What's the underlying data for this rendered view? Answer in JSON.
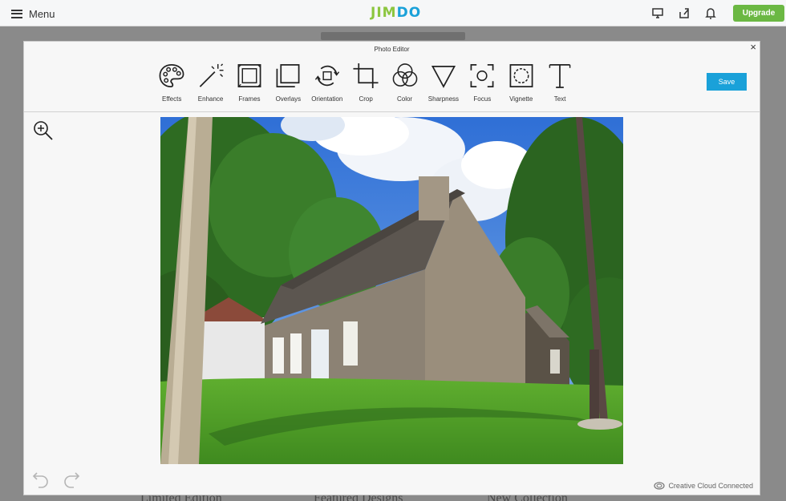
{
  "topbar": {
    "menu_label": "Menu",
    "logo_part1": "JIM",
    "logo_part2": "DO",
    "upgrade_label": "Upgrade",
    "icons": [
      "desktop-icon",
      "share-icon",
      "bell-icon"
    ]
  },
  "background": {
    "links": [
      "Limited Edition",
      "Featured Designs",
      "New Collection"
    ]
  },
  "editor": {
    "title": "Photo Editor",
    "save_label": "Save",
    "close_label": "×",
    "cc_label": "Creative Cloud Connected",
    "tools": [
      {
        "label": "Effects",
        "icon": "palette-icon"
      },
      {
        "label": "Enhance",
        "icon": "magic-wand-icon"
      },
      {
        "label": "Frames",
        "icon": "frame-icon"
      },
      {
        "label": "Overlays",
        "icon": "overlays-icon"
      },
      {
        "label": "Orientation",
        "icon": "rotate-icon"
      },
      {
        "label": "Crop",
        "icon": "crop-icon"
      },
      {
        "label": "Color",
        "icon": "color-circles-icon"
      },
      {
        "label": "Sharpness",
        "icon": "triangle-icon"
      },
      {
        "label": "Focus",
        "icon": "focus-icon"
      },
      {
        "label": "Vignette",
        "icon": "vignette-icon"
      },
      {
        "label": "Text",
        "icon": "text-icon"
      }
    ]
  },
  "colors": {
    "accent": "#1aa1d9",
    "upgrade": "#6bb843"
  }
}
